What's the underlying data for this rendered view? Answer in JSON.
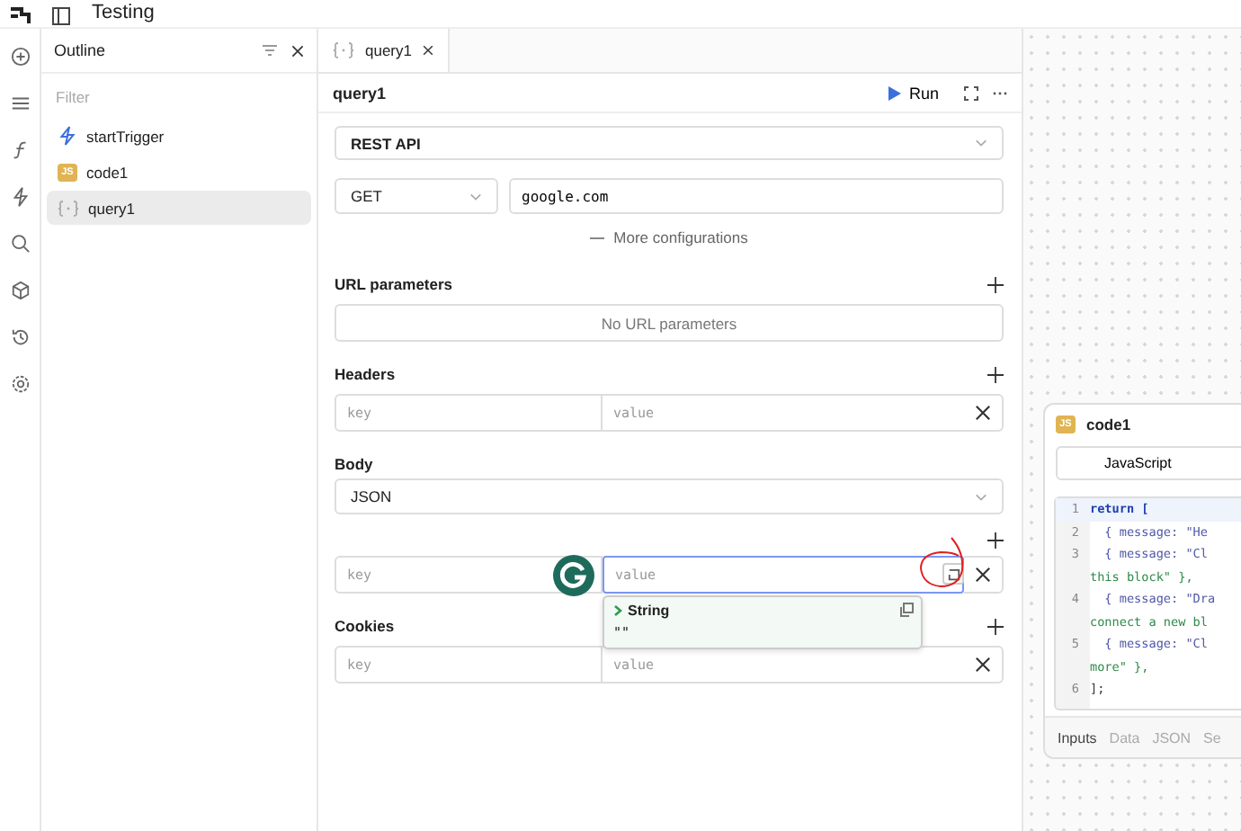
{
  "top_bar": {
    "title": "Testing"
  },
  "outline": {
    "title": "Outline",
    "filter_placeholder": "Filter",
    "items": [
      {
        "label": "startTrigger",
        "kind": "trigger",
        "selected": false
      },
      {
        "label": "code1",
        "kind": "js",
        "badge": "JS",
        "selected": false
      },
      {
        "label": "query1",
        "kind": "query",
        "selected": true
      }
    ]
  },
  "editor_tabs": [
    {
      "label": "query1",
      "selected": true
    }
  ],
  "query": {
    "title": "query1",
    "run_label": "Run",
    "resource": "REST API",
    "method": "GET",
    "url": "google.com",
    "more_label": "More configurations",
    "url_params": {
      "label": "URL parameters",
      "empty": "No URL parameters"
    },
    "headers": {
      "label": "Headers",
      "rows": [
        {
          "key_placeholder": "key",
          "value_placeholder": "value",
          "focused": false
        }
      ]
    },
    "body": {
      "label": "Body",
      "type": "JSON",
      "rows": [
        {
          "key_placeholder": "key",
          "value_placeholder": "value",
          "focused": true
        }
      ]
    },
    "cookies": {
      "label": "Cookies",
      "rows": [
        {
          "key_placeholder": "key",
          "value_placeholder": "value",
          "focused": false
        }
      ]
    }
  },
  "tooltip": {
    "type": "String",
    "value": "\"\""
  },
  "code_card": {
    "title": "code1",
    "badge": "JS",
    "language": "JavaScript",
    "lines": [
      {
        "number": "1",
        "text": "return [",
        "kind": "keyword",
        "active": true
      },
      {
        "number": "2",
        "text": "  { message: \"He",
        "kind": "object",
        "active": false
      },
      {
        "number": "3",
        "text": "  { message: \"Cl",
        "kind": "object",
        "active": false
      },
      {
        "text": "this block\" },",
        "kind": "string",
        "active": false
      },
      {
        "number": "4",
        "text": "  { message: \"Dra",
        "kind": "object",
        "active": false
      },
      {
        "text": "connect a new bl",
        "kind": "string",
        "active": false
      },
      {
        "number": "5",
        "text": "  { message: \"Cl",
        "kind": "object",
        "active": false
      },
      {
        "text": "more\" },",
        "kind": "string",
        "active": false
      },
      {
        "number": "6",
        "text": "];",
        "kind": "plain",
        "active": false
      }
    ],
    "tabs": [
      {
        "label": "Inputs",
        "selected": true
      },
      {
        "label": "Data",
        "selected": false
      },
      {
        "label": "JSON",
        "selected": false
      },
      {
        "label": "Se",
        "selected": false
      }
    ]
  }
}
